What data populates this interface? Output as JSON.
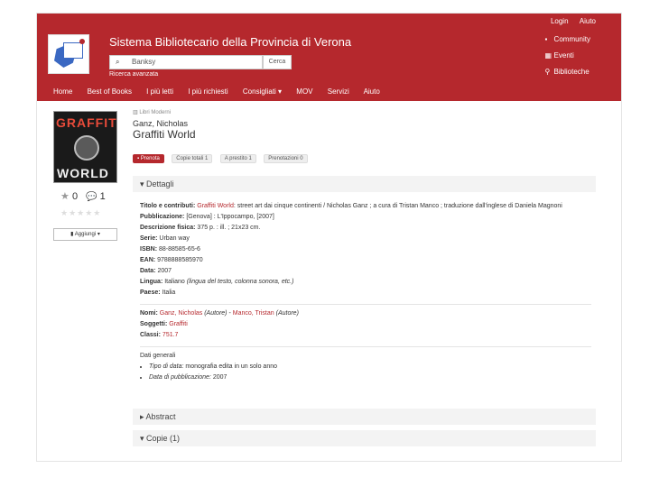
{
  "header": {
    "login": "Login",
    "help": "Aiuto",
    "site_title": "Sistema Bibliotecario della Provincia di Verona",
    "search_value": "Banksy",
    "search_button": "Cerca",
    "advanced_search": "Ricerca avanzata",
    "right_links": [
      "Community",
      "Eventi",
      "Biblioteche"
    ],
    "nav": [
      "Home",
      "Best of Books",
      "I più letti",
      "I più richiesti",
      "Consigliati ▾",
      "MOV",
      "Servizi",
      "Aiuto"
    ]
  },
  "cover": {
    "line1": "GRAFFITI",
    "line2": "WORLD"
  },
  "sidebar": {
    "rating_count": "0",
    "comment_count": "1",
    "stars": "★★★★★",
    "add_button": "Aggiungi ▾"
  },
  "record": {
    "type": "Libri Moderni",
    "author": "Ganz, Nicholas",
    "title": "Graffiti World",
    "buttons": [
      "Prenota",
      "Copie totali 1",
      "A prestito 1",
      "Prenotazioni 0"
    ]
  },
  "sections": {
    "details": "Dettagli",
    "abstract": "Abstract",
    "copies": "Copie (1)"
  },
  "details": {
    "titolo_label": "Titolo e contributi:",
    "titolo_link": "Graffiti World",
    "titolo_rest": ": street art dai cinque continenti / Nicholas Ganz ; a cura di Tristan Manco ; traduzione dall'inglese di Daniela Magnoni",
    "pubblicazione_label": "Pubblicazione:",
    "pubblicazione": "[Genova] : L'Ippocampo, [2007]",
    "descrizione_label": "Descrizione fisica:",
    "descrizione": "375 p. : ill. ; 21x23 cm.",
    "serie_label": "Serie:",
    "serie": "Urban way",
    "isbn_label": "ISBN:",
    "isbn": "88-88585-65-6",
    "ean_label": "EAN:",
    "ean": "9788888585970",
    "data_label": "Data:",
    "data": "2007",
    "lingua_label": "Lingua:",
    "lingua": "Italiano",
    "lingua_note": "(lingua del testo, colonna sonora, etc.)",
    "paese_label": "Paese:",
    "paese": "Italia",
    "nomi_label": "Nomi:",
    "nome1": "Ganz, Nicholas",
    "nome1_role": "(Autore)",
    "nome2": "Manco, Tristan",
    "nome2_role": "(Autore)",
    "soggetti_label": "Soggetti:",
    "soggetti": "Graffiti",
    "classi_label": "Classi:",
    "classi": "751.7",
    "generali_label": "Dati generali",
    "gen1_label": "Tipo di data:",
    "gen1": "monografia edita in un solo anno",
    "gen2_label": "Data di pubblicazione:",
    "gen2": "2007"
  }
}
